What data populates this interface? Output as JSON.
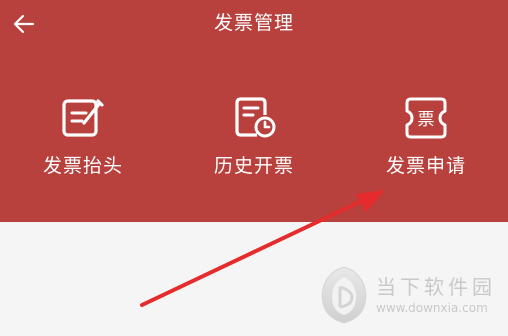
{
  "header": {
    "title": "发票管理",
    "back_icon": "arrow-left-icon",
    "background": "#b8403d"
  },
  "actions": [
    {
      "label": "发票抬头",
      "icon": "edit-document-icon"
    },
    {
      "label": "历史开票",
      "icon": "document-history-icon"
    },
    {
      "label": "发票申请",
      "icon": "ticket-icon",
      "icon_text": "票"
    }
  ],
  "annotation": {
    "icon": "red-arrow-icon",
    "color": "#e52b2b"
  },
  "watermark": {
    "name": "当下软件园",
    "url": "www.downxia.com",
    "icon": "downxia-logo-icon"
  }
}
